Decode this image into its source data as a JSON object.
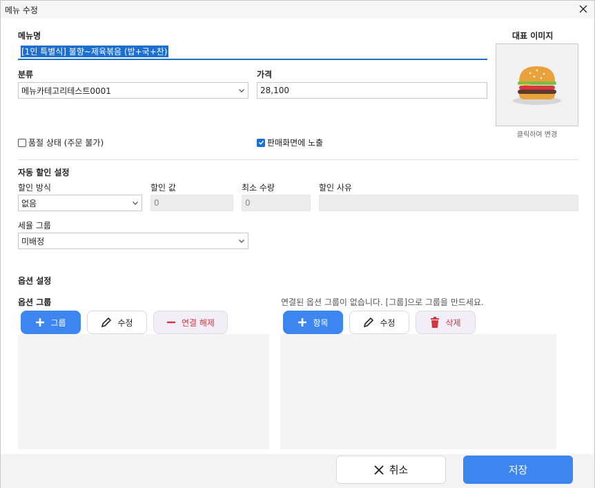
{
  "window": {
    "title": "메뉴 수정"
  },
  "menu_name": {
    "label": "메뉴명",
    "value": "[1인 특별식] 불향~제육볶음 (밥+국+찬)"
  },
  "category": {
    "label": "분류",
    "value": "메뉴카테고리테스트0001"
  },
  "price": {
    "label": "가격",
    "value": "28,100"
  },
  "image": {
    "label": "대표 이미지",
    "caption": "클릭하여 변경",
    "icon": "burger-icon"
  },
  "soldout": {
    "label": "품절 상태 (주문 불가)",
    "checked": false
  },
  "display": {
    "label": "판매화면에 노출",
    "checked": true
  },
  "discount": {
    "section_title": "자동 할인 설정",
    "method_label": "할인 방식",
    "method_value": "없음",
    "value_label": "할인 값",
    "value_value": "0",
    "min_qty_label": "최소 수량",
    "min_qty_value": "0",
    "reason_label": "할인 사유",
    "reason_value": ""
  },
  "tax": {
    "label": "세율 그룹",
    "value": "미배정"
  },
  "options": {
    "section_title": "옵션 설정",
    "group_label": "옵션 그룹",
    "empty_message": "연결된 옵션 그룹이 없습니다. [그룹]으로 그룹을 만드세요.",
    "left_buttons": {
      "add": "그룹",
      "edit": "수정",
      "unlink": "연결 해제"
    },
    "right_buttons": {
      "add": "항목",
      "edit": "수정",
      "delete": "삭제"
    }
  },
  "footer": {
    "cancel": "취소",
    "save": "저장"
  },
  "colors": {
    "accent": "#3d86ef",
    "danger": "#d4353a",
    "selection": "#1a6fd1"
  }
}
